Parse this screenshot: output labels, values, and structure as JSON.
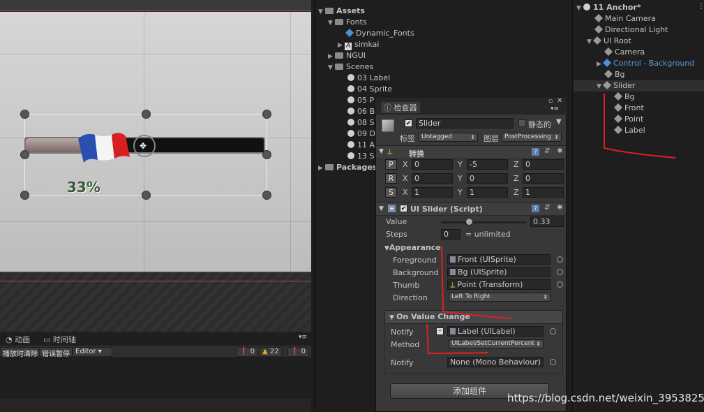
{
  "scene": {
    "percent_label": "33%"
  },
  "animation": {
    "tabs": [
      "动画",
      "时间轴"
    ],
    "toolbar": {
      "clear_on_play": "播放时清除",
      "error_pause": "错误暂停",
      "editor": "Editor"
    },
    "counts": {
      "errors": "0",
      "warnings": "22",
      "infos": "0"
    }
  },
  "project": {
    "items": [
      {
        "label": "Assets"
      },
      {
        "label": "Fonts"
      },
      {
        "label": "Dynamic_Fonts"
      },
      {
        "label": "simkai"
      },
      {
        "label": "NGUI"
      },
      {
        "label": "Scenes"
      },
      {
        "label": "03 Label"
      },
      {
        "label": "04 Sprite"
      },
      {
        "label": "05 P"
      },
      {
        "label": "06 B"
      },
      {
        "label": "08 S"
      },
      {
        "label": "09 D"
      },
      {
        "label": "11 A"
      },
      {
        "label": "13 S"
      },
      {
        "label": "Packages"
      }
    ]
  },
  "inspector": {
    "tab_label": "检查器",
    "object_name": "Slider",
    "static_label": "静态的",
    "tag_label": "标签",
    "tag_value": "Untagged",
    "layer_label": "图层",
    "layer_value": "PostProcessing",
    "transform": {
      "title": "转换",
      "rows": [
        {
          "btn": "P",
          "x": "0",
          "y": "-5",
          "z": "0"
        },
        {
          "btn": "R",
          "x": "0",
          "y": "0",
          "z": "0"
        },
        {
          "btn": "S",
          "x": "1",
          "y": "1",
          "z": "1"
        }
      ],
      "axis_x": "X",
      "axis_y": "Y",
      "axis_z": "Z"
    },
    "ui_slider": {
      "title": "UI Slider (Script)",
      "value_label": "Value",
      "value": "0.33",
      "value_fraction": 0.33,
      "steps_label": "Steps",
      "steps_value": "0",
      "steps_suffix": "= unlimited",
      "appearance_title": "Appearance",
      "foreground_label": "Foreground",
      "foreground_value": "Front (UISprite)",
      "background_label": "Background",
      "background_value": "Bg (UISprite)",
      "thumb_label": "Thumb",
      "thumb_value": "Point (Transform)",
      "direction_label": "Direction",
      "direction_value": "Left To Right",
      "on_value_change_title": "On Value Change",
      "notify_label": "Notify",
      "notify_value": "Label (UILabel)",
      "method_label": "Method",
      "method_value": "UILabel/SetCurrentPercent",
      "notify2_label": "Notify",
      "notify2_value": "None (Mono Behaviour)"
    },
    "add_component": "添加组件"
  },
  "hierarchy": {
    "scene_title": "11 Anchor*",
    "items": [
      {
        "label": "Main Camera"
      },
      {
        "label": "Directional Light"
      },
      {
        "label": "UI Root"
      },
      {
        "label": "Camera"
      },
      {
        "label": "Control - Background"
      },
      {
        "label": "Bg"
      },
      {
        "label": "Slider"
      },
      {
        "label": "Bg"
      },
      {
        "label": "Front"
      },
      {
        "label": "Point"
      },
      {
        "label": "Label"
      }
    ]
  },
  "watermark": "https://blog.csdn.net/weixin_39538253",
  "colors": {
    "accent_pink": "#b43c8c",
    "annotation_red": "#e02020",
    "prefab_blue": "#4f8fd8"
  }
}
